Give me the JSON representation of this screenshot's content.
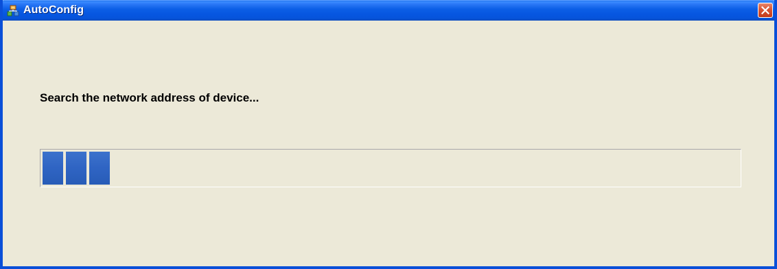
{
  "window": {
    "title": "AutoConfig",
    "icon": "app-network-icon",
    "close_icon": "close-icon",
    "close_label": "✕"
  },
  "dialog": {
    "message": "Search the network address of device...",
    "progress": {
      "value": 0.1,
      "indeterminate": false,
      "blocks_visible": 3
    }
  },
  "colors": {
    "titlebar": "#0a5ae0",
    "window_bg": "#ece9d8",
    "progress_block": "#3167c6",
    "close_button": "#d95533"
  }
}
